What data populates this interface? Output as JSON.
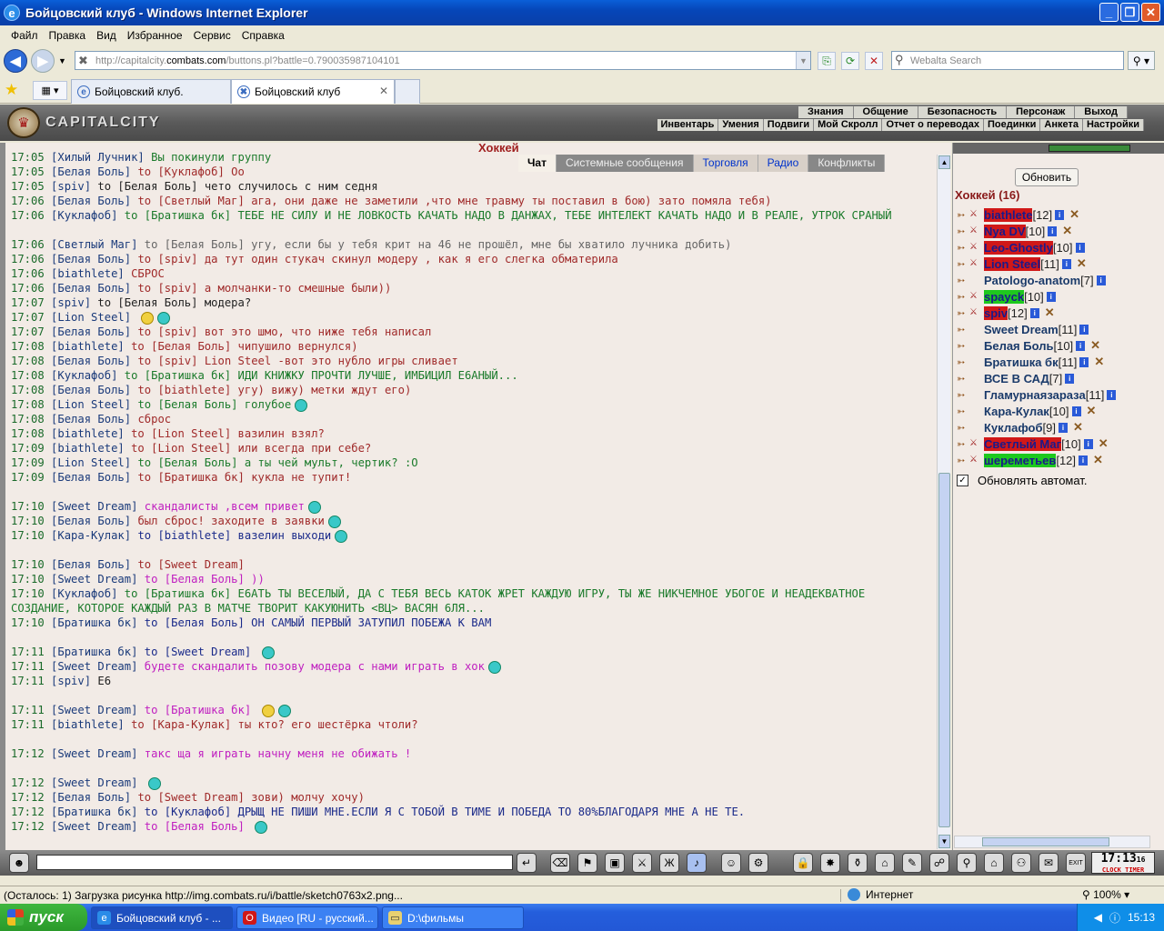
{
  "window": {
    "title": "Бойцовский клуб - Windows Internet Explorer"
  },
  "menu": [
    "Файл",
    "Правка",
    "Вид",
    "Избранное",
    "Сервис",
    "Справка"
  ],
  "address": {
    "prefix": "http://capitalcity.",
    "domain": "combats.com",
    "suffix": "/buttons.pl?battle=0.790035987104101"
  },
  "search": {
    "placeholder": "Webalta Search"
  },
  "tabs": [
    {
      "label": "Бойцовский клуб.",
      "active": false
    },
    {
      "label": "Бойцовский клуб",
      "active": true
    }
  ],
  "site": {
    "logo": "CAPITALCITY",
    "top_menu": [
      "Знания",
      "Общение",
      "Безопасность",
      "Персонаж",
      "Выход"
    ],
    "bottom_menu": [
      "Инвентарь",
      "Умения",
      "Подвиги",
      "Мой Скролл",
      "Отчет о переводах",
      "Поединки",
      "Анкета",
      "Настройки"
    ]
  },
  "chat": {
    "room_title": "Хоккей",
    "tabs": [
      {
        "label": "Чат",
        "active": true
      },
      {
        "label": "Системные сообщения"
      },
      {
        "label": "Торговля"
      },
      {
        "label": "Радио"
      },
      {
        "label": "Конфликты"
      }
    ],
    "lines": [
      {
        "time": "17:05",
        "nick": "[Хилый Лучник]",
        "to": "",
        "text": "Вы покинули группу",
        "color": "#1a7a2a"
      },
      {
        "time": "17:05",
        "nick": "[Белая Боль]",
        "to": "to [Куклафоб]",
        "text": "Оо",
        "color": "#a02a2a"
      },
      {
        "time": "17:05",
        "nick": "[spiv]",
        "to": "to [Белая Боль]",
        "text": "чето случилось с ним седня",
        "color": "#222"
      },
      {
        "time": "17:06",
        "nick": "[Белая Боль]",
        "to": "to [Светлый Маг]",
        "text": "ага, они даже не заметили ,что мне травму ты поставил в бою) зато помяла тебя)",
        "color": "#a02a2a"
      },
      {
        "time": "17:06",
        "nick": "[Куклафоб]",
        "to": "to [Братишка бк]",
        "text": "ТЕБЕ НЕ СИЛУ И НЕ ЛОВКОСТЬ КАЧАТЬ НАДО В ДАНЖАХ, ТЕБЕ ИНТЕЛЕКТ КАЧАТЬ НАДО И В РЕАЛЕ, УТРОК СРАНЫЙ",
        "color": "#1a7a2a",
        "wrap": true
      },
      {
        "time": "17:06",
        "nick": "[Светлый Маг]",
        "to": "to [Белая Боль]",
        "text": "угу, если бы у тебя крит на 46 не прошёл, мне бы хватило лучника добить)",
        "color": "#666"
      },
      {
        "time": "17:06",
        "nick": "[Белая Боль]",
        "to": "to [spiv]",
        "text": "да тут один стукач скинул модеру , как я его слегка обматерила",
        "color": "#a02a2a"
      },
      {
        "time": "17:06",
        "nick": "[biathlete]",
        "to": "",
        "text": "СБРОС",
        "color": "#a02a2a"
      },
      {
        "time": "17:06",
        "nick": "[Белая Боль]",
        "to": "to [spiv]",
        "text": "а молчанки-то смешные были))",
        "color": "#a02a2a"
      },
      {
        "time": "17:07",
        "nick": "[spiv]",
        "to": "to [Белая Боль]",
        "text": "модера?",
        "color": "#222"
      },
      {
        "time": "17:07",
        "nick": "[Lion Steel]",
        "to": "",
        "text": "",
        "color": "#222",
        "emo": 2
      },
      {
        "time": "17:07",
        "nick": "[Белая Боль]",
        "to": "to [spiv]",
        "text": "вот это шмо, что ниже тебя написал",
        "color": "#a02a2a"
      },
      {
        "time": "17:08",
        "nick": "[biathlete]",
        "to": "to [Белая Боль]",
        "text": "чипушило вернулся)",
        "color": "#a02a2a"
      },
      {
        "time": "17:08",
        "nick": "[Белая Боль]",
        "to": "to [spiv]",
        "text": "Lion Steel -вот это нубло игры сливает",
        "color": "#a02a2a"
      },
      {
        "time": "17:08",
        "nick": "[Куклафоб]",
        "to": "to [Братишка бк]",
        "text": "ИДИ КНИЖКУ ПРОЧТИ ЛУЧШЕ, ИМБИЦИЛ Е6АНЫЙ...",
        "color": "#1a7a2a"
      },
      {
        "time": "17:08",
        "nick": "[Белая Боль]",
        "to": "to [biathlete]",
        "text": "угу) вижу) метки ждут его)",
        "color": "#a02a2a"
      },
      {
        "time": "17:08",
        "nick": "[Lion Steel]",
        "to": "to [Белая Боль]",
        "text": "голубое",
        "color": "#1a7a2a",
        "emo": 1
      },
      {
        "time": "17:08",
        "nick": "[Белая Боль]",
        "to": "",
        "text": "сброс",
        "color": "#a02a2a"
      },
      {
        "time": "17:08",
        "nick": "[biathlete]",
        "to": "to [Lion Steel]",
        "text": "вазилин взял?",
        "color": "#a02a2a"
      },
      {
        "time": "17:09",
        "nick": "[biathlete]",
        "to": "to [Lion Steel]",
        "text": "или всегда при себе?",
        "color": "#a02a2a"
      },
      {
        "time": "17:09",
        "nick": "[Lion Steel]",
        "to": "to [Белая Боль]",
        "text": "а ты чей мульт, чертик? :О",
        "color": "#1a7a2a"
      },
      {
        "time": "17:09",
        "nick": "[Белая Боль]",
        "to": "to [Братишка бк]",
        "text": "кукла не тупит!",
        "color": "#a02a2a"
      },
      {
        "time": "17:10",
        "nick": "[Sweet Dream]",
        "to": "",
        "text": "скандалисты ,всем привет",
        "color": "#c020c0",
        "tall": true,
        "emo": 1
      },
      {
        "time": "17:10",
        "nick": "[Белая Боль]",
        "to": "",
        "text": "был сброс! заходите в заявки",
        "color": "#a02a2a",
        "emo": 1
      },
      {
        "time": "17:10",
        "nick": "[Кара-Кулак]",
        "to": "to [biathlete]",
        "text": "вазелин выходи",
        "color": "#1a2a8a",
        "emo": 1
      },
      {
        "time": "17:10",
        "nick": "[Белая Боль]",
        "to": "to [Sweet Dream]",
        "text": "",
        "color": "#a02a2a",
        "tall": true
      },
      {
        "time": "17:10",
        "nick": "[Sweet Dream]",
        "to": "to [Белая Боль]",
        "text": "))",
        "color": "#c020c0"
      },
      {
        "time": "17:10",
        "nick": "[Куклафоб]",
        "to": "to [Братишка бк]",
        "text": "Е6АТЬ ТЫ ВЕСЕЛЫЙ, ДА С ТЕБЯ ВЕСЬ КАТОК ЖРЕТ КАЖДУЮ ИГРУ, ТЫ ЖЕ НИКЧЕМНОЕ УБОГОЕ И НЕАДЕКВАТНОЕ СОЗДАНИЕ, КОТОРОЕ КАЖДЫЙ РАЗ В МАТЧЕ ТВОРИТ КАКУЮНИТЬ <ВЦ> ВАСЯН 6ЛЯ...",
        "color": "#1a7a2a",
        "wrap": true
      },
      {
        "time": "17:10",
        "nick": "[Братишка бк]",
        "to": "to [Белая Боль]",
        "text": "ОН САМЫЙ ПЕРВЫЙ ЗАТУПИЛ ПОБЕЖА К ВАМ",
        "color": "#1a2a8a"
      },
      {
        "time": "17:11",
        "nick": "[Братишка бк]",
        "to": "to [Sweet Dream]",
        "text": "",
        "color": "#1a2a8a",
        "tall": true,
        "emo": 1
      },
      {
        "time": "17:11",
        "nick": "[Sweet Dream]",
        "to": "",
        "text": "будете скандалить позову модера с нами играть в хок",
        "color": "#c020c0",
        "emo": 1
      },
      {
        "time": "17:11",
        "nick": "[spiv]",
        "to": "",
        "text": "Е6",
        "color": "#222"
      },
      {
        "time": "17:11",
        "nick": "[Sweet Dream]",
        "to": "to [Братишка бк]",
        "text": "",
        "color": "#c020c0",
        "tall": true,
        "emo": 2
      },
      {
        "time": "17:11",
        "nick": "[biathlete]",
        "to": "to [Кара-Кулак]",
        "text": "ты кто? его шестёрка чтоли?",
        "color": "#a02a2a"
      },
      {
        "time": "17:12",
        "nick": "[Sweet Dream]",
        "to": "",
        "text": "такс ща я играть начну меня не обижать !",
        "color": "#c020c0",
        "tall": true
      },
      {
        "time": "17:12",
        "nick": "[Sweet Dream]",
        "to": "",
        "text": "",
        "color": "#c020c0",
        "tall": true,
        "emo": 1
      },
      {
        "time": "17:12",
        "nick": "[Белая Боль]",
        "to": "to [Sweet Dream]",
        "text": "зови) молчу хочу)",
        "color": "#a02a2a"
      },
      {
        "time": "17:12",
        "nick": "[Братишка бк]",
        "to": "to [Куклафоб]",
        "text": "ДРЫЩ НЕ ПИШИ МНЕ.ЕСЛИ Я С ТОБОЙ В ТИМЕ И ПОБЕДА ТО 80%БЛАГОДАРЯ МНЕ А НЕ ТЕ.",
        "color": "#1a2a8a"
      },
      {
        "time": "17:12",
        "nick": "[Sweet Dream]",
        "to": "to [Белая Боль]",
        "text": "",
        "color": "#c020c0",
        "emo": 1
      }
    ]
  },
  "room": {
    "refresh_label": "Обновить",
    "title": "Хоккей (16)",
    "players": [
      {
        "name": "biathlete",
        "level": "[12]",
        "style": "red",
        "cross": true
      },
      {
        "name": "Nya DV",
        "level": "[10]",
        "style": "red",
        "cross": true
      },
      {
        "name": "Leo-Ghostly",
        "level": "[10]",
        "style": "red",
        "cross": false
      },
      {
        "name": "Lion Steel",
        "level": "[11]",
        "style": "red",
        "cross": true
      },
      {
        "name": "Patologo-anatom",
        "level": "[7]",
        "style": "",
        "cross": false
      },
      {
        "name": "spayck",
        "level": "[10]",
        "style": "green",
        "cross": false
      },
      {
        "name": "spiv",
        "level": "[12]",
        "style": "red",
        "cross": true
      },
      {
        "name": "Sweet Dream",
        "level": "[11]",
        "style": "",
        "cross": false
      },
      {
        "name": "Белая Боль",
        "level": "[10]",
        "style": "",
        "cross": true
      },
      {
        "name": "Братишка бк",
        "level": "[11]",
        "style": "",
        "cross": true
      },
      {
        "name": "ВСЕ В САД",
        "level": "[7]",
        "style": "",
        "cross": false
      },
      {
        "name": "Гламурнаязараза",
        "level": "[11]",
        "style": "",
        "cross": false
      },
      {
        "name": "Кара-Кулак",
        "level": "[10]",
        "style": "",
        "cross": true
      },
      {
        "name": "Куклафоб",
        "level": "[9]",
        "style": "",
        "cross": true
      },
      {
        "name": "Светлый Маг",
        "level": "[10]",
        "style": "red",
        "cross": true
      },
      {
        "name": "шереметьев",
        "level": "[12]",
        "style": "green",
        "cross": true
      }
    ],
    "auto_update_label": "Обновлять автомат.",
    "auto_update_checked": true
  },
  "clock": {
    "time": "17:13",
    "seconds": "16",
    "label": "CLOCK TIMER"
  },
  "status": {
    "text": "(Осталось: 1) Загрузка рисунка http://img.combats.ru/i/battle/sketch0763x2.png...",
    "zone": "Интернет",
    "zoom": "100%"
  },
  "taskbar": {
    "start_label": "пуск",
    "tasks": [
      {
        "label": "Бойцовский клуб - ...",
        "active": true
      },
      {
        "label": "Видео [RU - русский...",
        "active": false
      },
      {
        "label": "D:\\фильмы",
        "active": false
      }
    ],
    "time": "15:13"
  }
}
